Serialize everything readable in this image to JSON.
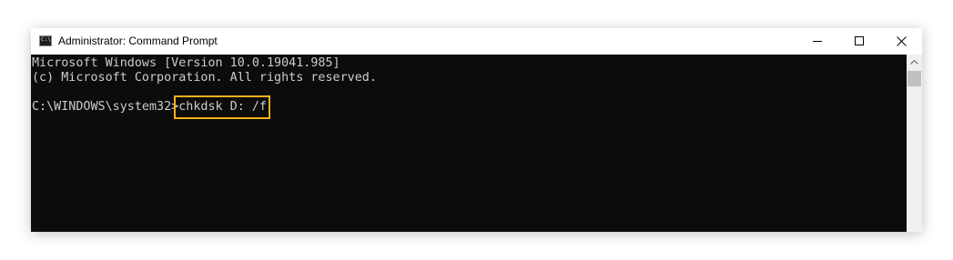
{
  "window": {
    "title": "Administrator: Command Prompt",
    "app_icon_text": "C:\\",
    "icons": {
      "app": "command-prompt-icon",
      "minimize": "minimize-icon",
      "maximize": "maximize-icon",
      "close": "close-icon",
      "scroll_up": "chevron-up-icon"
    }
  },
  "console": {
    "lines": [
      "Microsoft Windows [Version 10.0.19041.985]",
      "(c) Microsoft Corporation. All rights reserved."
    ],
    "prompt": "C:\\WINDOWS\\system32>",
    "command": "chkdsk D: /f"
  },
  "colors": {
    "console_background": "#0c0c0c",
    "console_text": "#cccccc",
    "highlight": "#f6b21c",
    "titlebar": "#ffffff"
  }
}
